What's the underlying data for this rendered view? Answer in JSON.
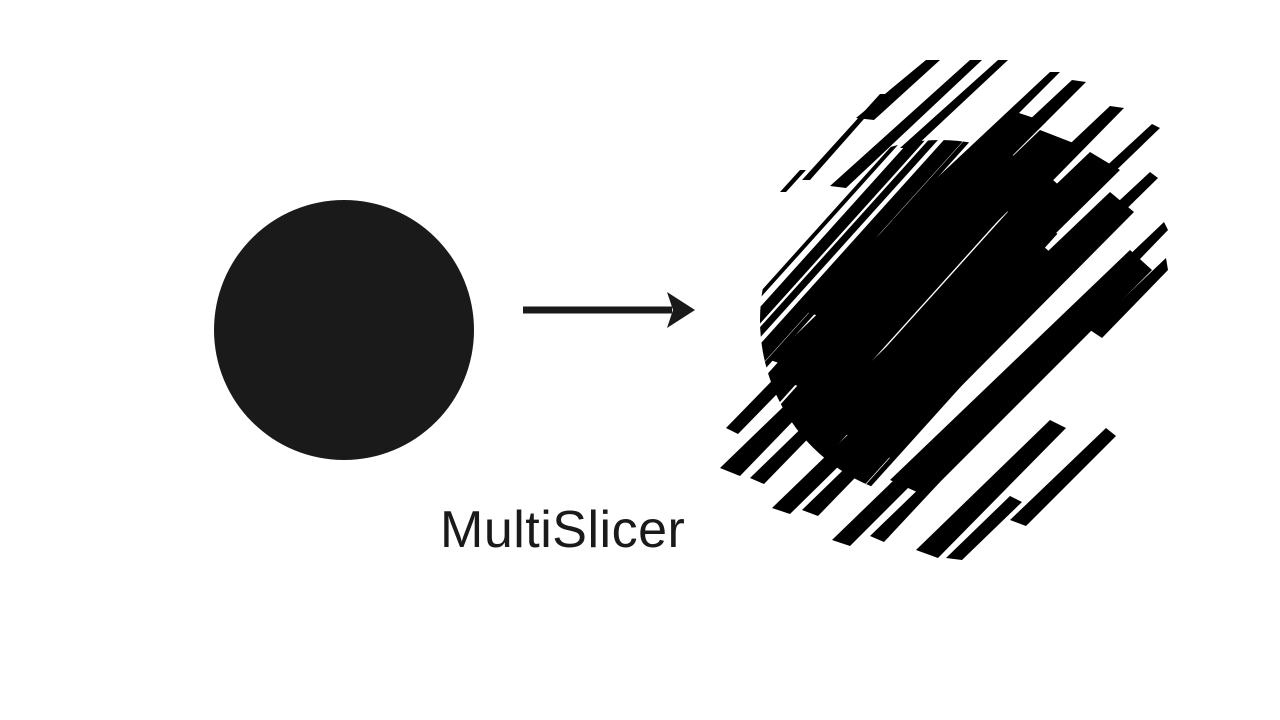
{
  "title": "MultiSlicer",
  "colors": {
    "fill": "#1a1a1a",
    "background": "#ffffff"
  },
  "shapes": {
    "input": "circle",
    "output": "sliced-diagonal-fragments"
  }
}
